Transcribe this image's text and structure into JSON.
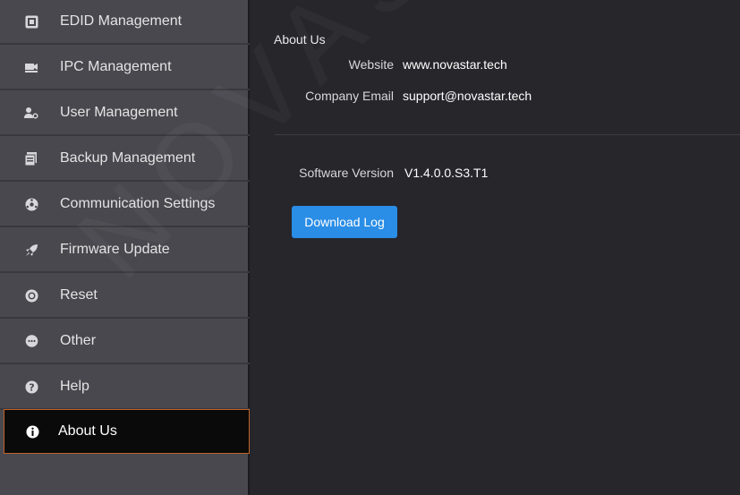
{
  "sidebar": {
    "items": [
      {
        "label": "EDID Management",
        "icon": "edid-icon"
      },
      {
        "label": "IPC Management",
        "icon": "camera-icon"
      },
      {
        "label": "User Management",
        "icon": "users-icon"
      },
      {
        "label": "Backup Management",
        "icon": "backup-icon"
      },
      {
        "label": "Communication Settings",
        "icon": "network-icon"
      },
      {
        "label": "Firmware Update",
        "icon": "rocket-icon"
      },
      {
        "label": "Reset",
        "icon": "reset-icon"
      },
      {
        "label": "Other",
        "icon": "chat-icon"
      },
      {
        "label": "Help",
        "icon": "help-icon"
      },
      {
        "label": "About Us",
        "icon": "info-icon",
        "active": true
      }
    ]
  },
  "about": {
    "title": "About Us",
    "website_label": "Website",
    "website_value": "www.novastar.tech",
    "email_label": "Company Email",
    "email_value": "support@novastar.tech",
    "version_label": "Software Version",
    "version_value": "V1.4.0.0.S3.T1",
    "download_button": "Download Log"
  },
  "watermark": "NOVASTAR TECH",
  "colors": {
    "sidebar_bg": "#48484e",
    "main_bg": "#26262b",
    "active_bg": "#0a0a0a",
    "active_border": "#c0642a",
    "button_bg": "#2a8de6"
  }
}
